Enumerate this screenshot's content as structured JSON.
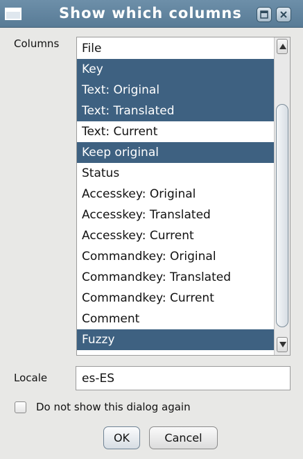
{
  "window": {
    "title": "Show which columns",
    "icon": "window-icon",
    "controls": [
      "maximize-icon",
      "close-icon"
    ]
  },
  "columns_label": "Columns",
  "columns": [
    {
      "label": "File",
      "selected": false
    },
    {
      "label": "Key",
      "selected": true
    },
    {
      "label": "Text: Original",
      "selected": true
    },
    {
      "label": "Text: Translated",
      "selected": true
    },
    {
      "label": "Text: Current",
      "selected": false
    },
    {
      "label": "Keep original",
      "selected": true
    },
    {
      "label": "Status",
      "selected": false
    },
    {
      "label": "Accesskey: Original",
      "selected": false
    },
    {
      "label": "Accesskey: Translated",
      "selected": false
    },
    {
      "label": "Accesskey: Current",
      "selected": false
    },
    {
      "label": "Commandkey: Original",
      "selected": false
    },
    {
      "label": "Commandkey: Translated",
      "selected": false
    },
    {
      "label": "Commandkey: Current",
      "selected": false
    },
    {
      "label": "Comment",
      "selected": false
    },
    {
      "label": "Fuzzy",
      "selected": true
    }
  ],
  "locale": {
    "label": "Locale",
    "value": "es-ES"
  },
  "dont_show_again": {
    "label": "Do not show this dialog again",
    "checked": false
  },
  "buttons": {
    "ok": "OK",
    "cancel": "Cancel"
  },
  "colors": {
    "titlebar": "#6088a4",
    "selection": "#3e6181",
    "dialog_background": "#e8e8e6"
  }
}
